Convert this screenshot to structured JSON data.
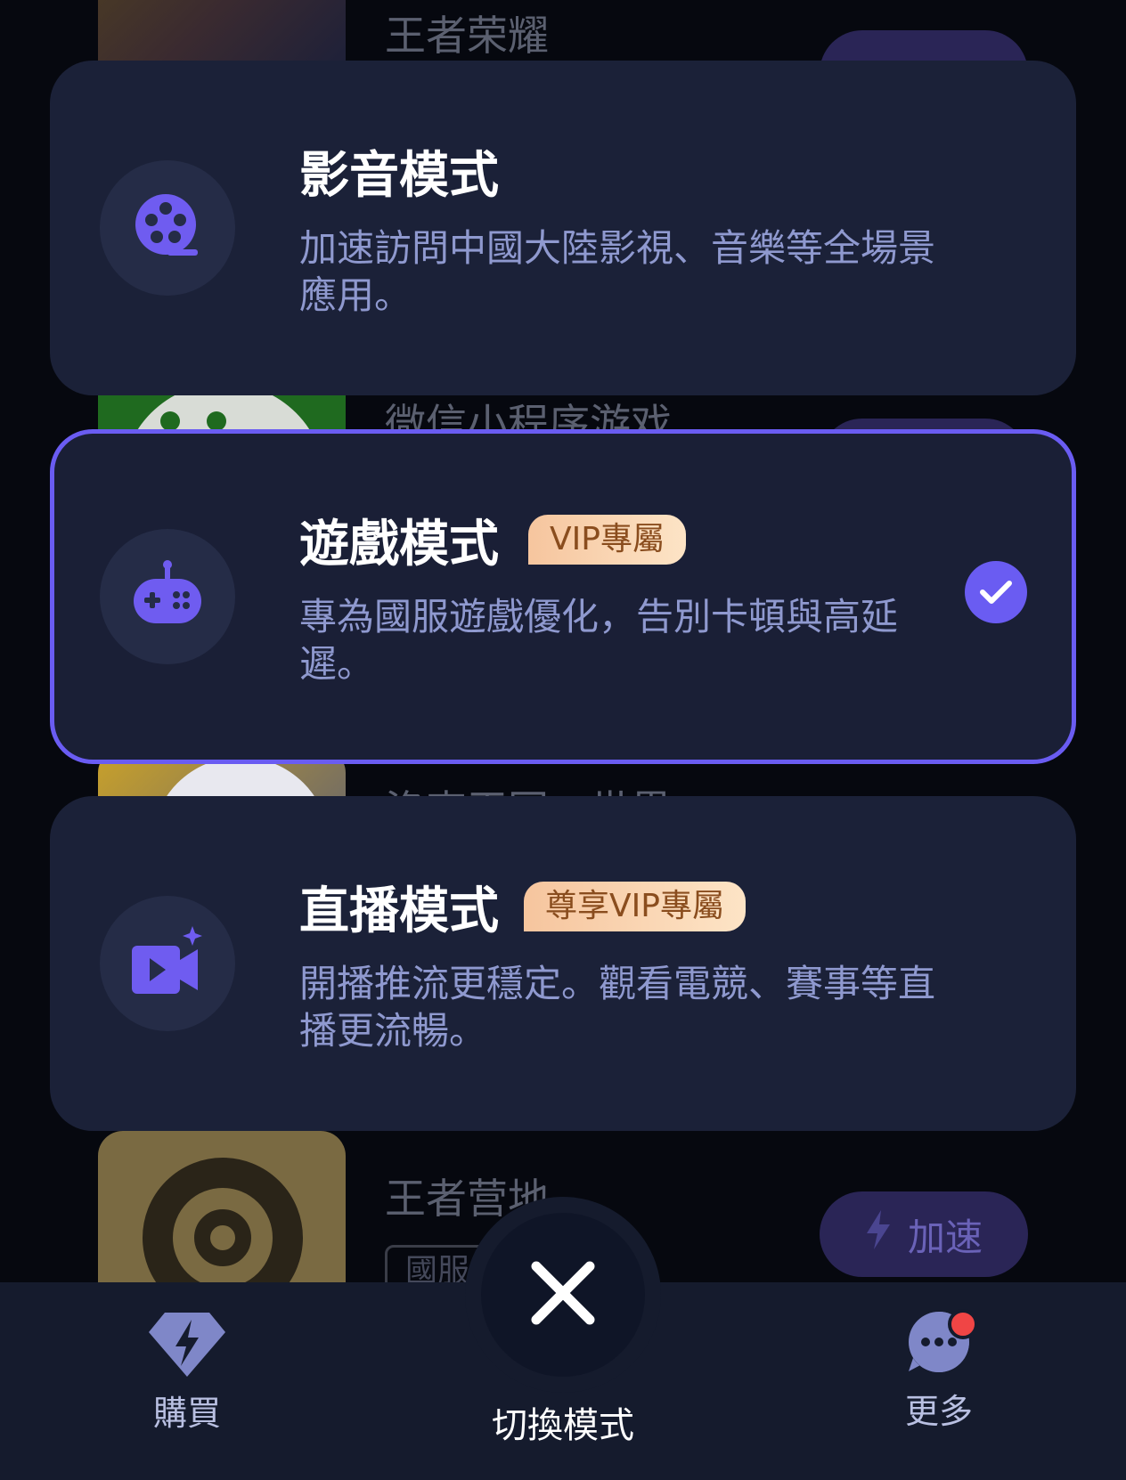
{
  "background_list": {
    "items": [
      {
        "title": "王者荣耀"
      },
      {
        "title": "微信小程序游戏"
      },
      {
        "title": "洛克王国：世界"
      },
      {
        "title": "王者营地",
        "tag": "國服",
        "button_label": "加速"
      }
    ]
  },
  "modes": [
    {
      "title": "影音模式",
      "badge": "",
      "description": "加速訪問中國大陸影視、音樂等全場景應用。",
      "icon": "film-reel-icon",
      "selected": false
    },
    {
      "title": "遊戲模式",
      "badge": "VIP專屬",
      "description": "專為國服遊戲優化，告別卡頓與高延遲。",
      "icon": "gamepad-icon",
      "selected": true
    },
    {
      "title": "直播模式",
      "badge": "尊享VIP專屬",
      "description": "開播推流更穩定。觀看電競、賽事等直播更流暢。",
      "icon": "live-camera-icon",
      "selected": false
    }
  ],
  "tabbar": {
    "left": {
      "label": "購買",
      "icon": "diamond-bolt-icon"
    },
    "center": {
      "label": "切換模式",
      "icon": "close-icon"
    },
    "right": {
      "label": "更多",
      "icon": "more-dots-icon",
      "has_notification": true
    }
  },
  "colors": {
    "accent": "#6a5cf2",
    "card_bg": "#1b2138",
    "badge_gold": "#f6c59e",
    "desc_text": "#8f99cf"
  }
}
